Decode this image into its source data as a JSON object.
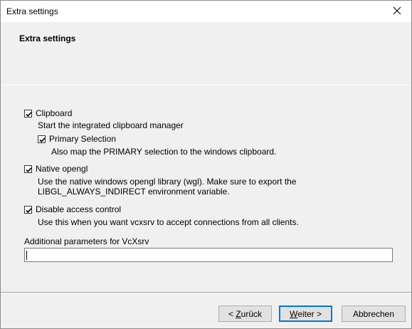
{
  "window": {
    "title": "Extra settings",
    "close_glyph": "✕"
  },
  "header": {
    "title": "Extra settings"
  },
  "options": {
    "clipboard": {
      "label": "Clipboard",
      "checked": true,
      "description": "Start the integrated clipboard manager"
    },
    "primary_selection": {
      "label": "Primary Selection",
      "checked": true,
      "description": "Also map the PRIMARY selection to the windows clipboard."
    },
    "native_opengl": {
      "label": "Native opengl",
      "checked": true,
      "description_line1": "Use the native windows opengl library (wgl). Make sure to export the",
      "description_line2": "LIBGL_ALWAYS_INDIRECT environment variable."
    },
    "disable_access_control": {
      "label": "Disable access control",
      "checked": true,
      "description": "Use this when you want vcxsrv to accept connections from all clients."
    }
  },
  "additional_params": {
    "label": "Additional parameters for VcXsrv",
    "value": ""
  },
  "buttons": {
    "back_prefix": "< ",
    "back_accel": "Z",
    "back_rest": "urück",
    "next_accel": "W",
    "next_rest": "eiter >",
    "cancel": "Abbrechen"
  },
  "icons": {
    "checkmark": "checkmark-icon",
    "close": "close-icon"
  }
}
